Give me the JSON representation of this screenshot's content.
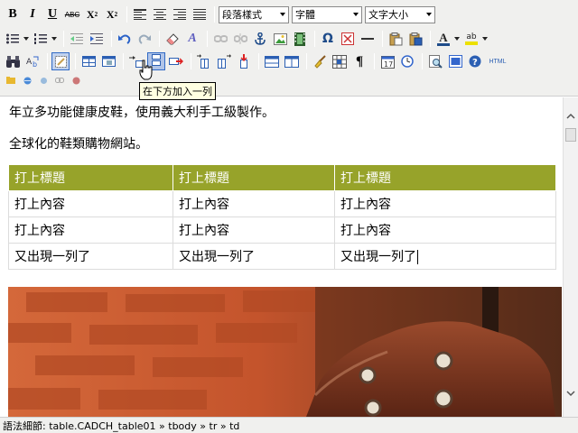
{
  "toolbar": {
    "row1": {
      "bold_label": "B",
      "italic_label": "I",
      "underline_label": "U",
      "strike_label": "ABC",
      "subscript_label": "X",
      "subscript_mark": "2",
      "superscript_label": "X",
      "superscript_mark": "2",
      "format_select": "段落樣式",
      "font_select": "字體",
      "size_select": "文字大小"
    },
    "row2": {
      "omega_label": "Ω",
      "text_color_label": "A",
      "hilite_label": "ab",
      "style_label": "A"
    },
    "row4": {
      "html_label": "HTML"
    },
    "tooltip": "在下方加入一列"
  },
  "editor": {
    "paragraphs": [
      "年立多功能健康皮鞋，使用義大利手工級製作。",
      "全球化的鞋類購物網站。"
    ],
    "table": {
      "headers": [
        "打上標題",
        "打上標題",
        "打上標題"
      ],
      "rows": [
        [
          "打上內容",
          "打上內容",
          "打上內容"
        ],
        [
          "打上內容",
          "打上內容",
          "打上內容"
        ],
        [
          "又出現一列了",
          "又出現一列了",
          "又出現一列了"
        ]
      ]
    }
  },
  "statusbar": {
    "path": "語法細節: table.CADCH_table01 » tbody » tr » td"
  },
  "colors": {
    "table_header_bg": "#97a32a",
    "toolbar_bg": "#f0f0ee",
    "selection_border": "#316ac5"
  }
}
